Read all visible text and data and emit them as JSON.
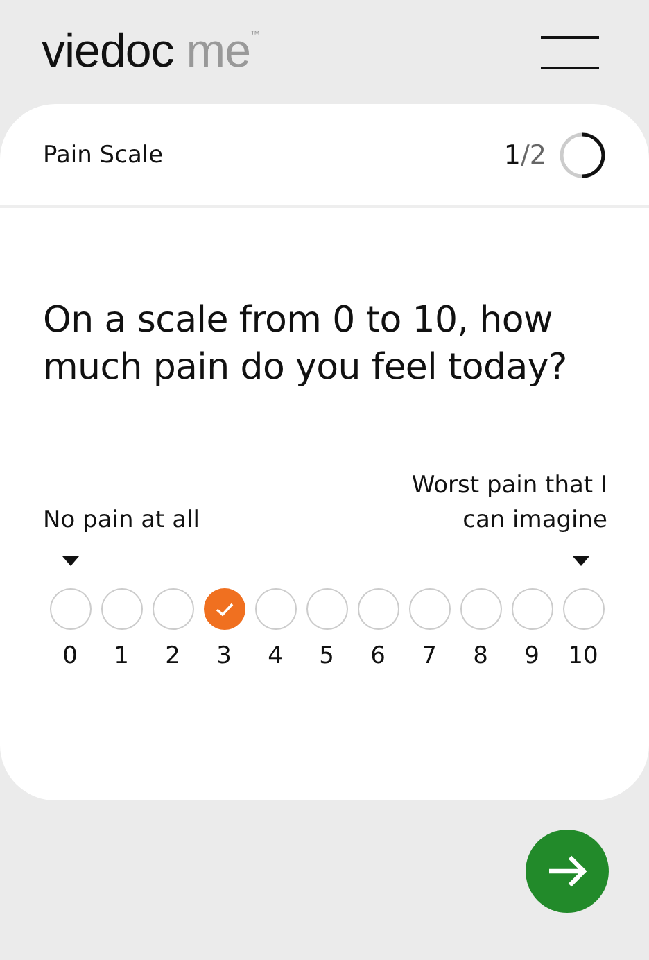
{
  "header": {
    "logo": {
      "brand": "viedoc",
      "product": "me",
      "mark": "™"
    }
  },
  "card": {
    "title": "Pain Scale",
    "progress": {
      "current": "1",
      "separator": "/",
      "total": "2",
      "level": 0.5
    },
    "question": "On a scale from 0 to 10, how much pain do you feel today?",
    "scale": {
      "min_label": "No pain at all",
      "max_label": "Worst pain that I can imagine",
      "options": [
        {
          "label": "0",
          "selected": false
        },
        {
          "label": "1",
          "selected": false
        },
        {
          "label": "2",
          "selected": false
        },
        {
          "label": "3",
          "selected": true
        },
        {
          "label": "4",
          "selected": false
        },
        {
          "label": "5",
          "selected": false
        },
        {
          "label": "6",
          "selected": false
        },
        {
          "label": "7",
          "selected": false
        },
        {
          "label": "8",
          "selected": false
        },
        {
          "label": "9",
          "selected": false
        },
        {
          "label": "10",
          "selected": false
        }
      ]
    }
  }
}
